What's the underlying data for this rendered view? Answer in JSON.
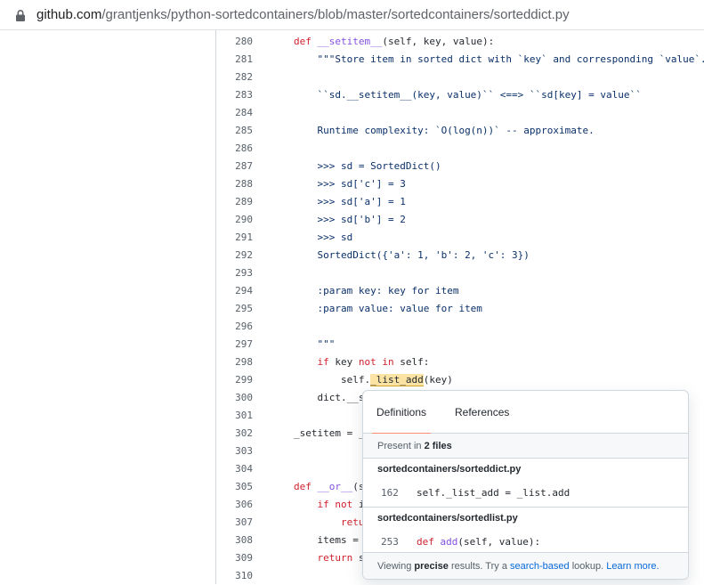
{
  "browser": {
    "url_host": "github.com",
    "url_path": "/grantjenks/python-sortedcontainers/blob/master/sortedcontainers/sorteddict.py"
  },
  "code": {
    "lines": [
      {
        "n": "280",
        "html": "<span class=\"kw\">def</span> <span class=\"fn\">__setitem__</span>(self, key, value):"
      },
      {
        "n": "281",
        "html": "    <span class=\"str\">\"\"\"Store item in sorted dict with `key` and corresponding `value`.</span>"
      },
      {
        "n": "282",
        "html": ""
      },
      {
        "n": "283",
        "html": "    <span class=\"str\">``sd.__setitem__(key, value)`` &lt;==&gt; ``sd[key] = value``</span>"
      },
      {
        "n": "284",
        "html": ""
      },
      {
        "n": "285",
        "html": "    <span class=\"str\">Runtime complexity: `O(log(n))` -- approximate.</span>"
      },
      {
        "n": "286",
        "html": ""
      },
      {
        "n": "287",
        "html": "    <span class=\"str\">&gt;&gt;&gt; sd = SortedDict()</span>"
      },
      {
        "n": "288",
        "html": "    <span class=\"str\">&gt;&gt;&gt; sd['c'] = 3</span>"
      },
      {
        "n": "289",
        "html": "    <span class=\"str\">&gt;&gt;&gt; sd['a'] = 1</span>"
      },
      {
        "n": "290",
        "html": "    <span class=\"str\">&gt;&gt;&gt; sd['b'] = 2</span>"
      },
      {
        "n": "291",
        "html": "    <span class=\"str\">&gt;&gt;&gt; sd</span>"
      },
      {
        "n": "292",
        "html": "    <span class=\"str\">SortedDict({'a': 1, 'b': 2, 'c': 3})</span>"
      },
      {
        "n": "293",
        "html": ""
      },
      {
        "n": "294",
        "html": "    <span class=\"str\">:param key: key for item</span>"
      },
      {
        "n": "295",
        "html": "    <span class=\"str\">:param value: value for item</span>"
      },
      {
        "n": "296",
        "html": ""
      },
      {
        "n": "297",
        "html": "    <span class=\"str\">\"\"\"</span>"
      },
      {
        "n": "298",
        "html": "    <span class=\"kw\">if</span> key <span class=\"kw\">not</span> <span class=\"kw\">in</span> self:"
      },
      {
        "n": "299",
        "html": "        self.<span class=\"hl\">_list_add</span>(key)"
      },
      {
        "n": "300",
        "html": "    dict.__s"
      },
      {
        "n": "301",
        "html": ""
      },
      {
        "n": "302",
        "html": "_setitem = _"
      },
      {
        "n": "303",
        "html": ""
      },
      {
        "n": "304",
        "html": ""
      },
      {
        "n": "305",
        "html": "<span class=\"kw\">def</span> <span class=\"fn\">__or__</span>(s"
      },
      {
        "n": "306",
        "html": "    <span class=\"kw\">if</span> <span class=\"kw\">not</span> i"
      },
      {
        "n": "307",
        "html": "        <span class=\"kw\">retu</span>"
      },
      {
        "n": "308",
        "html": "    items = "
      },
      {
        "n": "309",
        "html": "    <span class=\"kw\">return</span> s"
      },
      {
        "n": "310",
        "html": ""
      }
    ]
  },
  "popover": {
    "tab_definitions": "Definitions",
    "tab_references": "References",
    "present_prefix": "Present in ",
    "present_count": "2 files",
    "results": [
      {
        "file": "sortedcontainers/sorteddict.py",
        "line": "162",
        "code": "self._list_add = _list.add"
      },
      {
        "file": "sortedcontainers/sortedlist.py",
        "line": "253",
        "code": "def add(self, value):"
      }
    ],
    "footer_prefix": "Viewing ",
    "footer_bold": "precise",
    "footer_mid": " results. Try a ",
    "footer_link1": "search-based",
    "footer_mid2": " lookup. ",
    "footer_link2": "Learn more."
  }
}
